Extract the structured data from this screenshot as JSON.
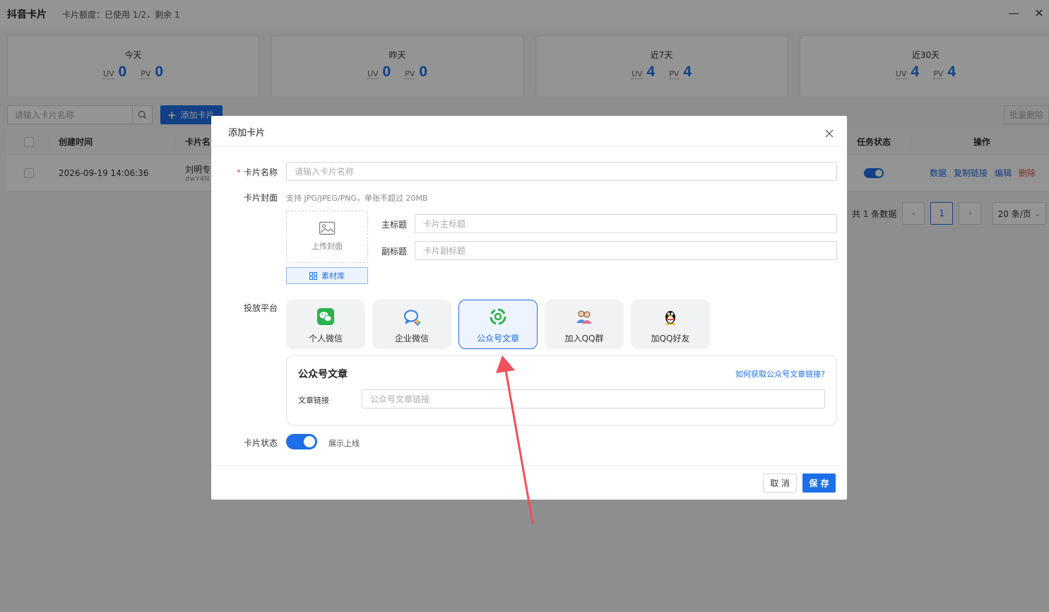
{
  "window": {
    "title": "抖音卡片",
    "quota": "卡片额度：已使用 1/2，剩余 1",
    "minimize_icon": "minimize-icon",
    "close_icon": "close-icon"
  },
  "stats": [
    {
      "title": "今天",
      "uv_label": "UV",
      "uv": "0",
      "pv_label": "PV",
      "pv": "0"
    },
    {
      "title": "昨天",
      "uv_label": "UV",
      "uv": "0",
      "pv_label": "PV",
      "pv": "0"
    },
    {
      "title": "近7天",
      "uv_label": "UV",
      "uv": "4",
      "pv_label": "PV",
      "pv": "4"
    },
    {
      "title": "近30天",
      "uv_label": "UV",
      "uv": "4",
      "pv_label": "PV",
      "pv": "4"
    }
  ],
  "toolbar": {
    "search_placeholder": "请输入卡片名称",
    "add_label": "添加卡片",
    "batch_delete_label": "批量删除"
  },
  "table": {
    "headers": {
      "created": "创建时间",
      "name": "卡片名",
      "status": "任务状态",
      "ops": "操作"
    },
    "rows": [
      {
        "created": "2026-09-19 14:06:36",
        "name": "刘明专",
        "sub": "dwY4N",
        "status_on": true
      }
    ],
    "ops": {
      "data": "数据",
      "copy": "复制链接",
      "edit": "编辑",
      "delete": "删除"
    }
  },
  "pager": {
    "total": "共 1 条数据",
    "current": "1",
    "size": "20 条/页"
  },
  "modal": {
    "title": "添加卡片",
    "name_label": "卡片名称",
    "name_placeholder": "请输入卡片名称",
    "cover_label": "卡片封面",
    "cover_hint": "支持 JPG/JPEG/PNG，单张不超过 20MB",
    "upload_label": "上传封面",
    "material_label": "素材库",
    "main_title_label": "主标题",
    "main_title_placeholder": "卡片主标题",
    "sub_title_label": "副标题",
    "sub_title_placeholder": "卡片副标题",
    "platform_label": "投放平台",
    "platforms": [
      {
        "label": "个人微信",
        "icon": "wechat-icon"
      },
      {
        "label": "企业微信",
        "icon": "wecom-icon"
      },
      {
        "label": "公众号文章",
        "icon": "official-account-icon"
      },
      {
        "label": "加入QQ群",
        "icon": "qq-group-icon"
      },
      {
        "label": "加QQ好友",
        "icon": "qq-penguin-icon"
      }
    ],
    "selected_platform": "公众号文章",
    "article": {
      "title": "公众号文章",
      "help_link": "如何获取公众号文章链接?",
      "link_label": "文章链接",
      "link_placeholder": "公众号文章链接"
    },
    "status_label": "卡片状态",
    "status_text": "展示上线",
    "status_on": true,
    "cancel_label": "取 消",
    "save_label": "保 存"
  },
  "colors": {
    "primary": "#1e6fe8",
    "danger": "#e84b4b",
    "annotation_arrow": "#f0505a"
  }
}
